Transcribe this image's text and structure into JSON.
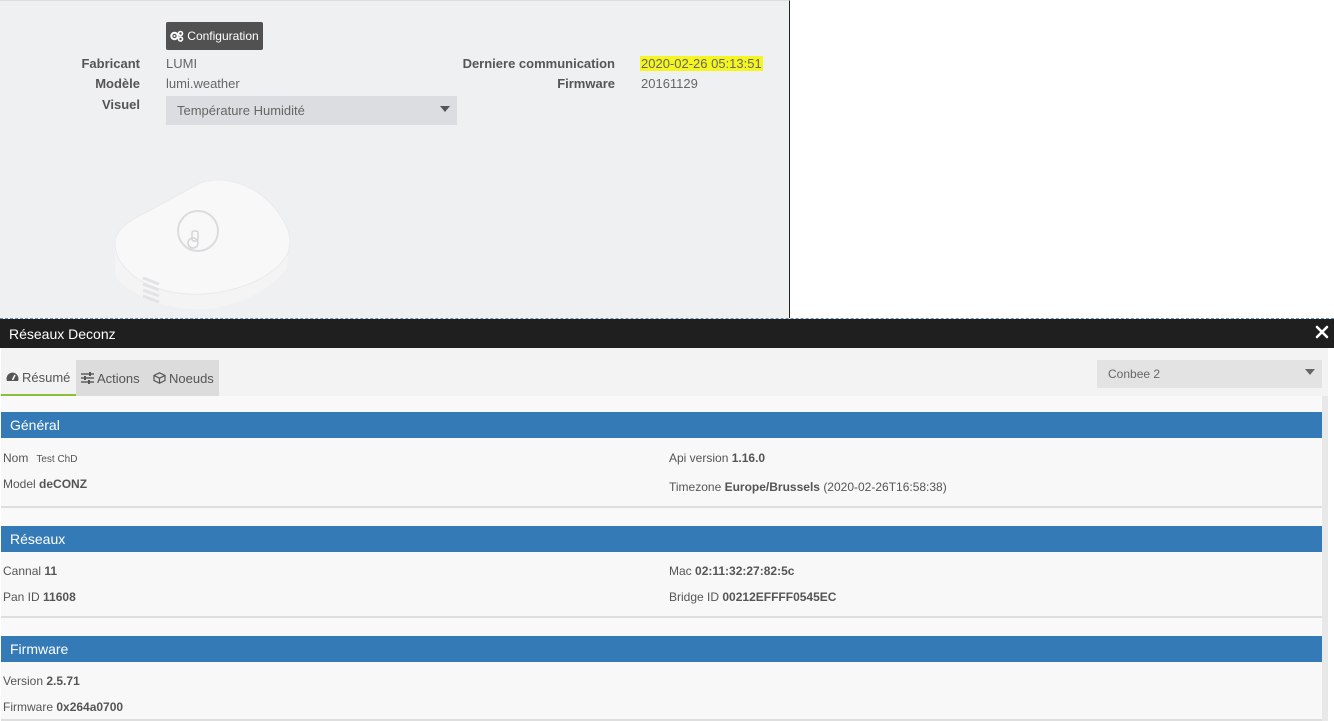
{
  "device": {
    "config_button": "Configuration",
    "fields": {
      "fabricant_label": "Fabricant",
      "fabricant_value": "LUMI",
      "modele_label": "Modèle",
      "modele_value": "lumi.weather",
      "visuel_label": "Visuel",
      "visuel_value": "Température Humidité",
      "derniere_label": "Derniere communication",
      "derniere_value": "2020-02-26 05:13:51",
      "firmware_label": "Firmware",
      "firmware_value": "20161129"
    },
    "highlight_color": "#f5f521"
  },
  "modal": {
    "title": "Réseaux Deconz",
    "tabs": [
      {
        "label": "Résumé",
        "icon": "dashboard-icon"
      },
      {
        "label": "Actions",
        "icon": "sliders-icon"
      },
      {
        "label": "Noeuds",
        "icon": "nodes-icon"
      }
    ],
    "network_select": "Conbee 2",
    "sections": {
      "general": {
        "title": "Général",
        "nom_label": "Nom",
        "nom_value": "Test ChD",
        "model_label": "Model",
        "model_value": "deCONZ",
        "api_label": "Api version",
        "api_value": "1.16.0",
        "tz_label": "Timezone",
        "tz_value": "Europe/Brussels",
        "tz_extra": "(2020-02-26T16:58:38)"
      },
      "reseaux": {
        "title": "Réseaux",
        "cannal_label": "Cannal",
        "cannal_value": "11",
        "panid_label": "Pan ID",
        "panid_value": "11608",
        "mac_label": "Mac",
        "mac_value": "02:11:32:27:82:5c",
        "bridge_label": "Bridge ID",
        "bridge_value": "00212EFFFF0545EC"
      },
      "firmware": {
        "title": "Firmware",
        "version_label": "Version",
        "version_value": "2.5.71",
        "fw_label": "Firmware",
        "fw_value": "0x264a0700"
      }
    },
    "colors": {
      "section_header": "#337ab7",
      "modal_header": "#1f1f1f",
      "active_tab_accent": "#8bbf3b"
    }
  }
}
